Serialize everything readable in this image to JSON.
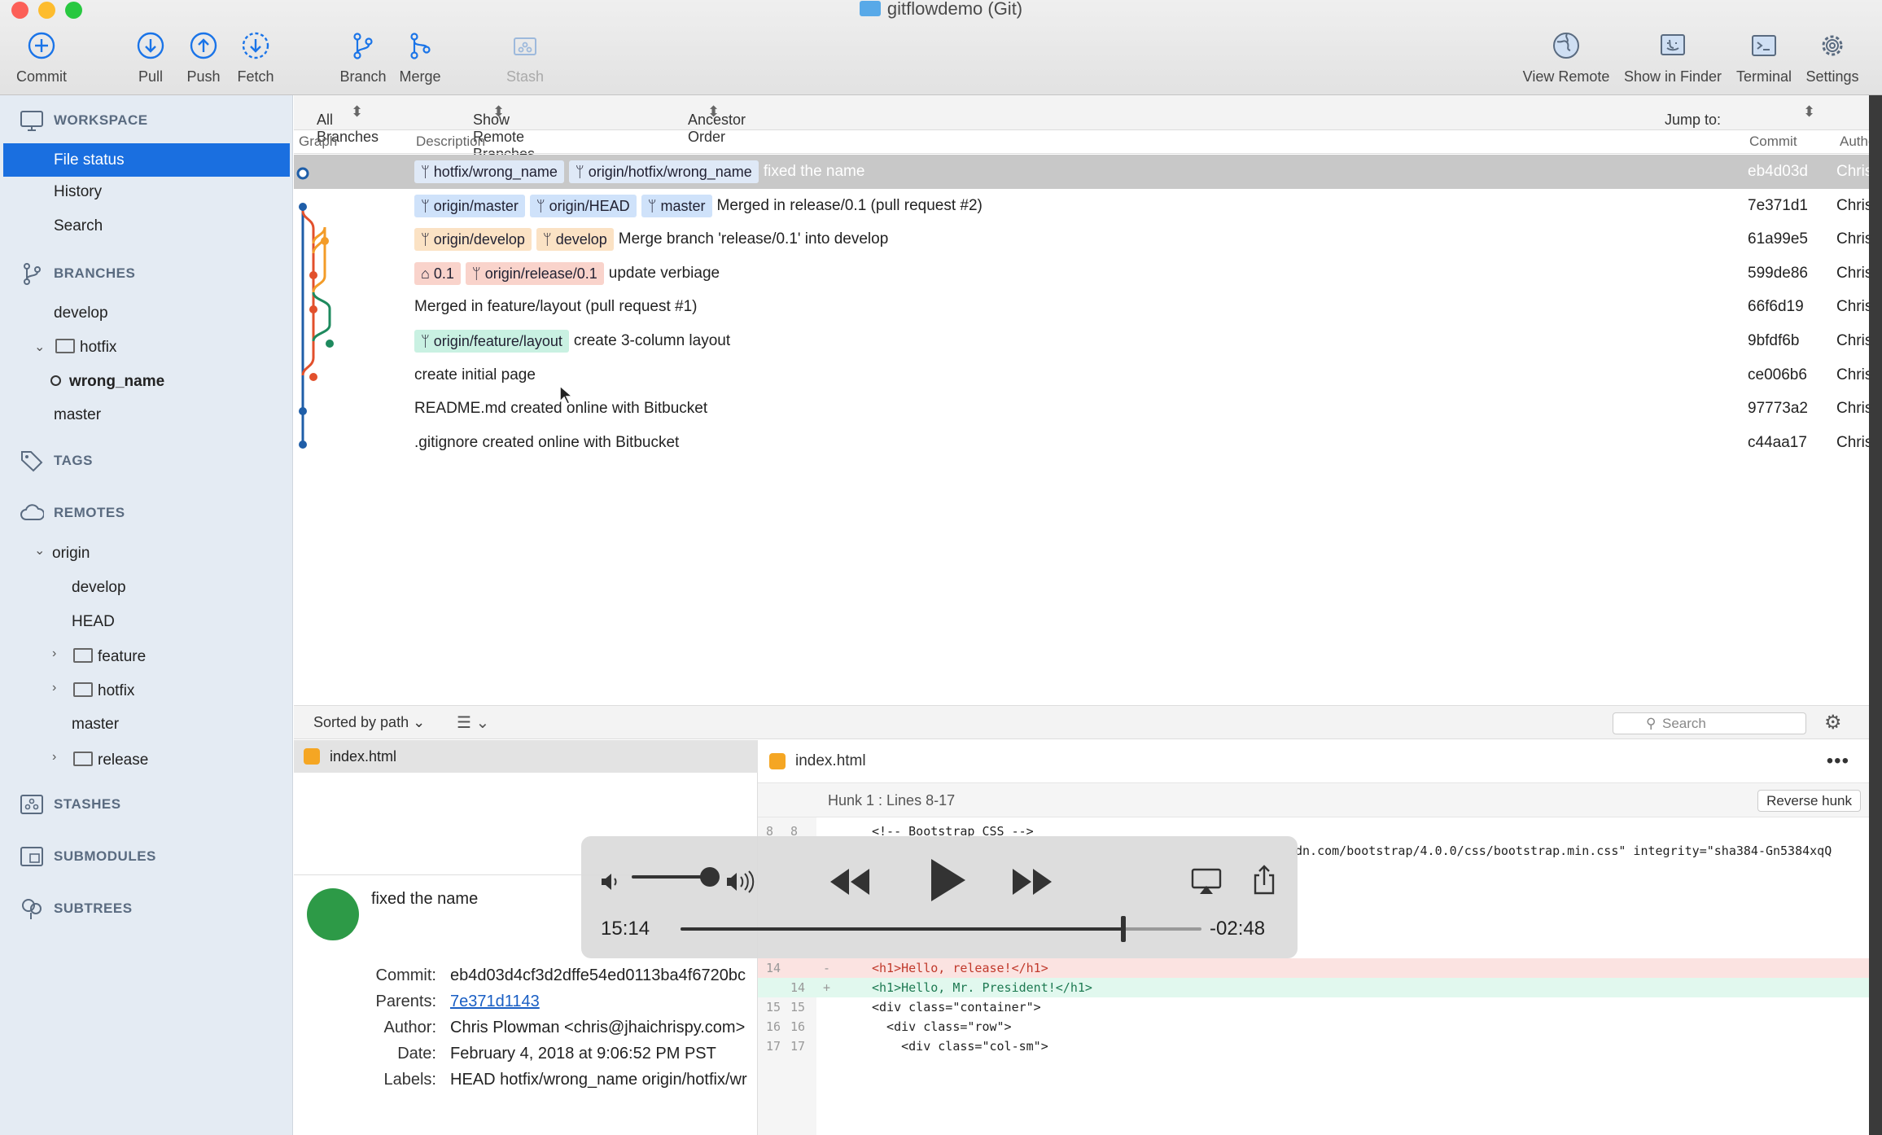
{
  "window": {
    "title": "gitflowdemo (Git)"
  },
  "toolbar": {
    "commit": "Commit",
    "pull": "Pull",
    "push": "Push",
    "fetch": "Fetch",
    "branch": "Branch",
    "merge": "Merge",
    "stash": "Stash",
    "view_remote": "View Remote",
    "show_in_finder": "Show in Finder",
    "terminal": "Terminal",
    "settings": "Settings"
  },
  "sidebar": {
    "workspace": "WORKSPACE",
    "file_status": "File status",
    "history": "History",
    "search": "Search",
    "branches": "BRANCHES",
    "develop": "develop",
    "hotfix": "hotfix",
    "wrong_name": "wrong_name",
    "master": "master",
    "tags": "TAGS",
    "remotes": "REMOTES",
    "origin": "origin",
    "r_develop": "develop",
    "r_head": "HEAD",
    "r_feature": "feature",
    "r_hotfix": "hotfix",
    "r_master": "master",
    "r_release": "release",
    "stashes": "STASHES",
    "submodules": "SUBMODULES",
    "subtrees": "SUBTREES"
  },
  "filters": {
    "branches": "All Branches",
    "remote": "Show Remote Branches",
    "order": "Ancestor Order",
    "jump": "Jump to:"
  },
  "columns": {
    "graph": "Graph",
    "description": "Description",
    "commit": "Commit",
    "author": "Author"
  },
  "commits": [
    {
      "tags": [
        "hotfix/wrong_name",
        "origin/hotfix/wrong_name"
      ],
      "message": "fixed the name",
      "hash": "eb4d03d",
      "author": "Chris"
    },
    {
      "tags": [
        "origin/master",
        "origin/HEAD",
        "master"
      ],
      "message": "Merged in release/0.1 (pull request #2)",
      "hash": "7e371d1",
      "author": "Chris"
    },
    {
      "tags": [
        "origin/develop",
        "develop"
      ],
      "message": "Merge branch 'release/0.1' into develop",
      "hash": "61a99e5",
      "author": "Chris"
    },
    {
      "tags": [
        "0.1",
        "origin/release/0.1"
      ],
      "message": "update verbiage",
      "hash": "599de86",
      "author": "Chris"
    },
    {
      "tags": [],
      "message": "Merged in feature/layout (pull request #1)",
      "hash": "66f6d19",
      "author": "Chris"
    },
    {
      "tags": [
        "origin/feature/layout"
      ],
      "message": "create 3-column layout",
      "hash": "9bfdf6b",
      "author": "Chris"
    },
    {
      "tags": [],
      "message": "create initial page",
      "hash": "ce006b6",
      "author": "Chris"
    },
    {
      "tags": [],
      "message": "README.md created online with Bitbucket",
      "hash": "97773a2",
      "author": "Chris"
    },
    {
      "tags": [],
      "message": ".gitignore created online with Bitbucket",
      "hash": "c44aa17",
      "author": "Chris"
    }
  ],
  "lower": {
    "sorted": "Sorted by path",
    "search_placeholder": "Search",
    "file": "index.html"
  },
  "details": {
    "message": "fixed the name",
    "commit_label": "Commit:",
    "commit": "eb4d03d4cf3d2dffe54ed0113ba4f6720bc",
    "parents_label": "Parents:",
    "parents": "7e371d1143",
    "author_label": "Author:",
    "author": "Chris Plowman <chris@jhaichrispy.com>",
    "date_label": "Date:",
    "date": "February 4, 2018 at 9:06:52 PM PST",
    "labels_label": "Labels:",
    "labels": "HEAD hotfix/wrong_name origin/hotfix/wr"
  },
  "diff": {
    "file": "index.html",
    "hunk": "Hunk 1 : Lines 8-17",
    "reverse": "Reverse hunk",
    "lines": [
      {
        "old": "8",
        "new": "8",
        "sign": "",
        "code": "<!-- Bootstrap CSS -->",
        "type": "ctx"
      },
      {
        "old": "",
        "new": "",
        "sign": "",
        "code": "dn.com/bootstrap/4.0.0/css/bootstrap.min.css\" integrity=\"sha384-Gn5384xqQ",
        "type": "ctx"
      },
      {
        "old": "14",
        "new": "",
        "sign": "-",
        "code": "<h1>Hello, release!</h1>",
        "type": "del"
      },
      {
        "old": "",
        "new": "14",
        "sign": "+",
        "code": "<h1>Hello, Mr. President!</h1>",
        "type": "add"
      },
      {
        "old": "15",
        "new": "15",
        "sign": "",
        "code": "<div class=\"container\">",
        "type": "ctx"
      },
      {
        "old": "16",
        "new": "16",
        "sign": "",
        "code": "  <div class=\"row\">",
        "type": "ctx"
      },
      {
        "old": "17",
        "new": "17",
        "sign": "",
        "code": "    <div class=\"col-sm\">",
        "type": "ctx"
      }
    ]
  },
  "player": {
    "elapsed": "15:14",
    "remaining": "-02:48",
    "progress": 0.85,
    "volume": 0.8
  },
  "colors": {
    "accent": "#1a6fe0",
    "master": "#1f5ea8",
    "develop": "#f39c28",
    "release": "#e2502c",
    "feature": "#1e8a5e"
  }
}
